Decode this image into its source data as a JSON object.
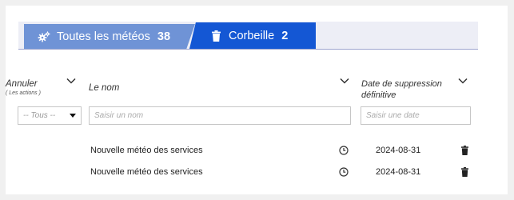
{
  "tabs": [
    {
      "label": "Toutes les météos",
      "count": "38",
      "icon": "gears-icon",
      "active": false
    },
    {
      "label": "Corbeille",
      "count": "2",
      "icon": "trash-icon",
      "active": true
    }
  ],
  "columns": {
    "annuler": {
      "title": "Annuler",
      "subtitle": "( Les actions )"
    },
    "nom": {
      "title": "Le nom"
    },
    "date": {
      "title": "Date de suppression définitive"
    }
  },
  "filters": {
    "annuler_select_value": "-- Tous --",
    "nom_placeholder": "Saisir un nom",
    "date_placeholder": "Saisir une date"
  },
  "rows": [
    {
      "name": "Nouvelle météo des services",
      "date": "2024-08-31"
    },
    {
      "name": "Nouvelle météo des services",
      "date": "2024-08-31"
    }
  ],
  "colors": {
    "tab_active": "#1457d4",
    "tab_inactive": "#6f93d6",
    "tab_strip": "#edeef6"
  }
}
